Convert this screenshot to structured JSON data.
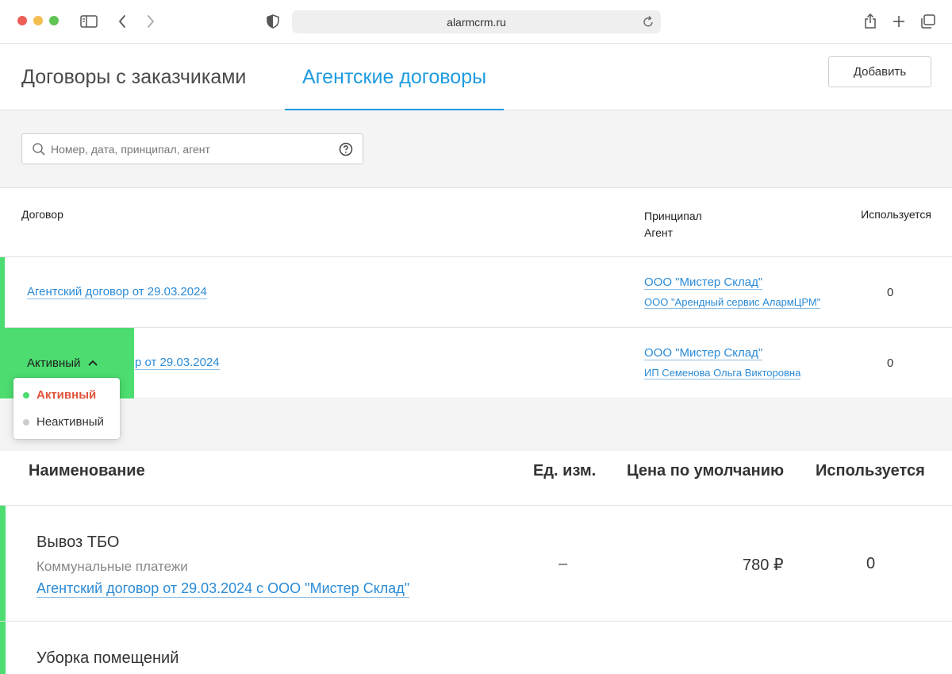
{
  "browser": {
    "url": "alarmcrm.ru"
  },
  "tabs": {
    "customers": "Договоры с заказчиками",
    "agent": "Агентские договоры",
    "add_button": "Добавить"
  },
  "search": {
    "placeholder": "Номер, дата, принципал, агент"
  },
  "contracts": {
    "headers": {
      "contract": "Договор",
      "principal": "Принципал",
      "agent": "Агент",
      "used": "Используется"
    },
    "rows": [
      {
        "name": "Агентский договор от 29.03.2024",
        "principal": "ООО \"Мистер Склад\"",
        "agent": "ООО \"Арендный сервис АлармЦРМ\"",
        "used": "0"
      },
      {
        "name": "р от 29.03.2024",
        "principal": "ООО \"Мистер Склад\"",
        "agent": "ИП Семенова Ольга Викторовна",
        "used": "0"
      }
    ]
  },
  "status": {
    "current": "Активный",
    "options": [
      {
        "label": "Активный",
        "color": "#4cdc6f",
        "selected": true
      },
      {
        "label": "Неактивный",
        "color": "#cccccc",
        "selected": false
      }
    ]
  },
  "services": {
    "headers": {
      "name": "Наименование",
      "unit": "Ед. изм.",
      "price": "Цена по умолчанию",
      "used": "Используется"
    },
    "rows": [
      {
        "title": "Вывоз ТБО",
        "category": "Коммунальные платежи",
        "contract_link": "Агентский договор от 29.03.2024 с ООО \"Мистер Склад\"",
        "unit": "–",
        "price": "780 ₽",
        "used": "0"
      },
      {
        "title": "Уборка помещений"
      }
    ]
  },
  "colors": {
    "accent": "#1e9be0",
    "active_green": "#4cdc6f",
    "link": "#2b8bd6",
    "selected_option": "#e0533a"
  }
}
